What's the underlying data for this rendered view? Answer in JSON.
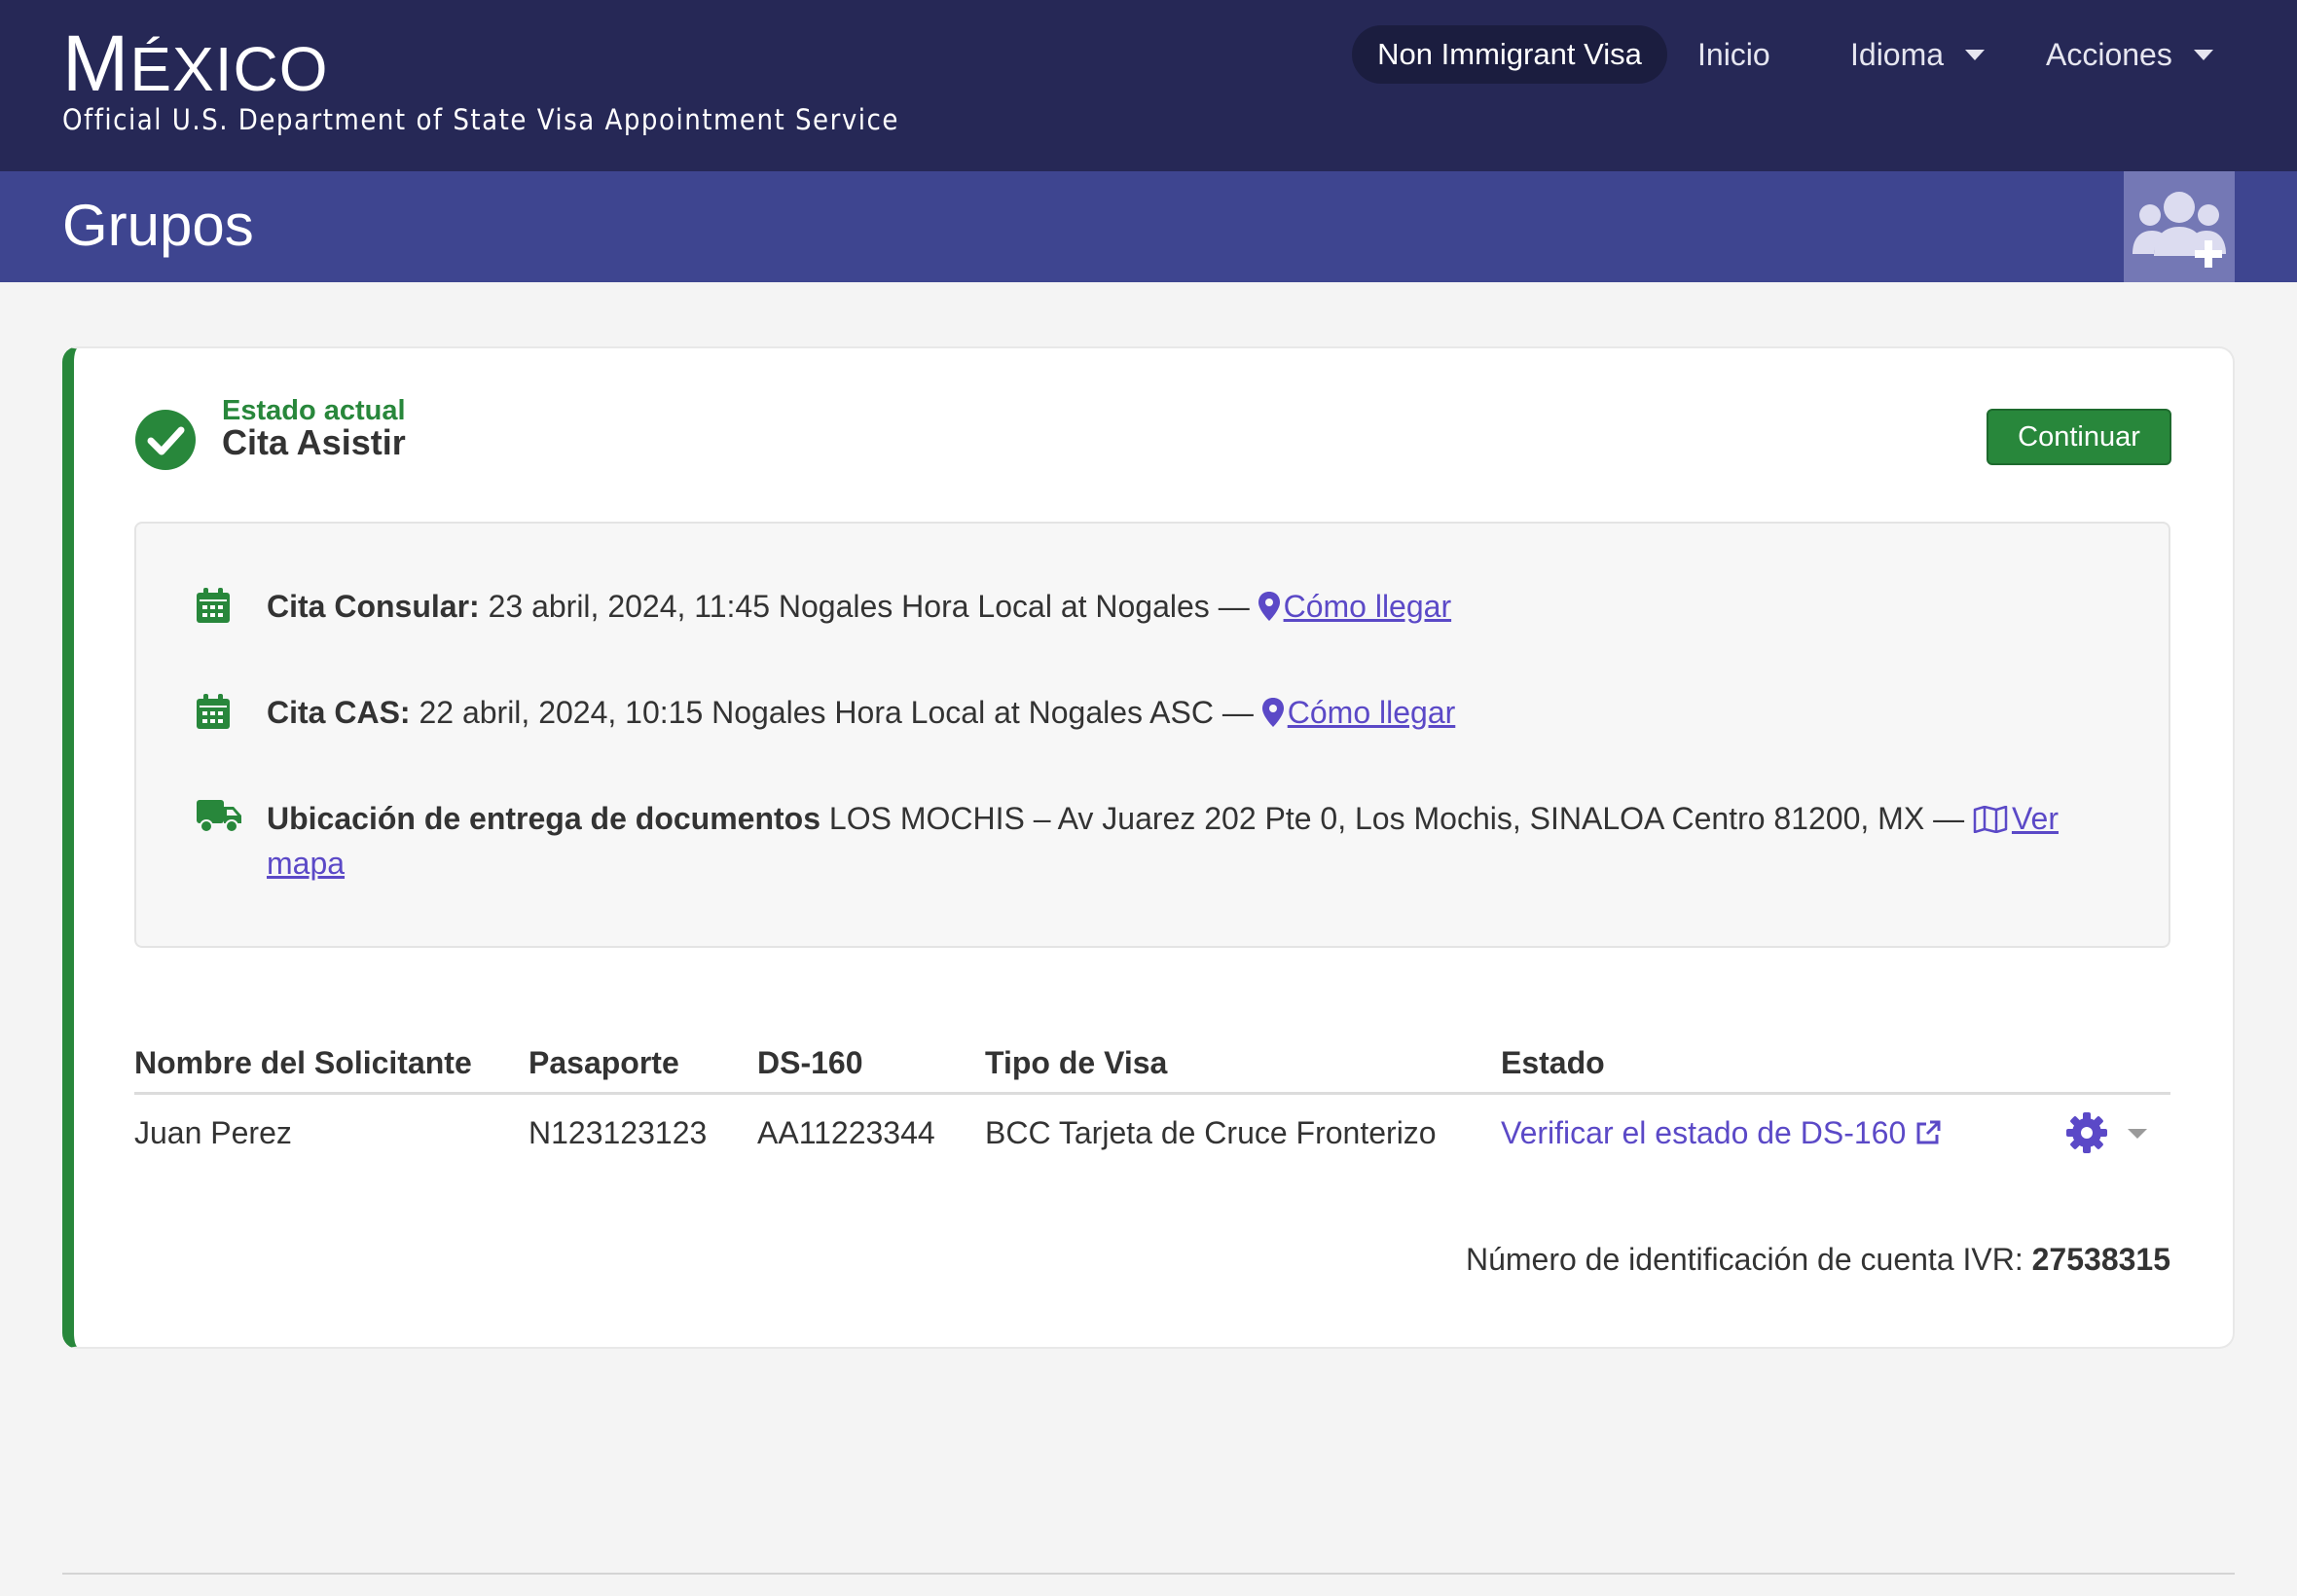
{
  "header": {
    "brand_first": "M",
    "brand_rest": "ÉXICO",
    "subtitle": "Official U.S. Department of State Visa Appointment Service",
    "nav": {
      "visa_type": "Non Immigrant Visa",
      "home": "Inicio",
      "language": "Idioma",
      "actions": "Acciones"
    }
  },
  "subheader": {
    "title": "Grupos",
    "group_icon": "users-plus-icon"
  },
  "status": {
    "label": "Estado actual",
    "value": "Cita Asistir",
    "continue_label": "Continuar",
    "icon": "check-circle-icon"
  },
  "appointments": {
    "consular": {
      "label": "Cita Consular:",
      "details": " 23 abril, 2024, 11:45 Nogales Hora Local at Nogales — ",
      "link": "Cómo llegar",
      "icon": "calendar-icon"
    },
    "cas": {
      "label": "Cita CAS:",
      "details": " 22 abril, 2024, 10:15 Nogales Hora Local at Nogales ASC — ",
      "link": "Cómo llegar",
      "icon": "calendar-icon"
    },
    "delivery": {
      "label": "Ubicación de entrega de documentos",
      "details": " LOS MOCHIS – Av Juarez 202 Pte 0, Los Mochis, SINALOA Centro 81200, MX — ",
      "link_part1": "Ver",
      "link_part2": "mapa",
      "icon": "truck-icon"
    }
  },
  "table": {
    "headers": [
      "Nombre del Solicitante",
      "Pasaporte",
      "DS-160",
      "Tipo de Visa",
      "Estado"
    ],
    "rows": [
      {
        "name": "Juan Perez",
        "passport": "N123123123",
        "ds160": "AA11223344",
        "visa_type": "BCC Tarjeta de Cruce Fronterizo",
        "status_link": "Verificar el estado de DS-160"
      }
    ]
  },
  "ivr": {
    "label": "Número de identificación de cuenta IVR: ",
    "number": "27538315"
  },
  "colors": {
    "header_bg": "#262856",
    "subheader_bg": "#3e4590",
    "accent_green": "#28873b",
    "link_purple": "#5b49c7"
  }
}
